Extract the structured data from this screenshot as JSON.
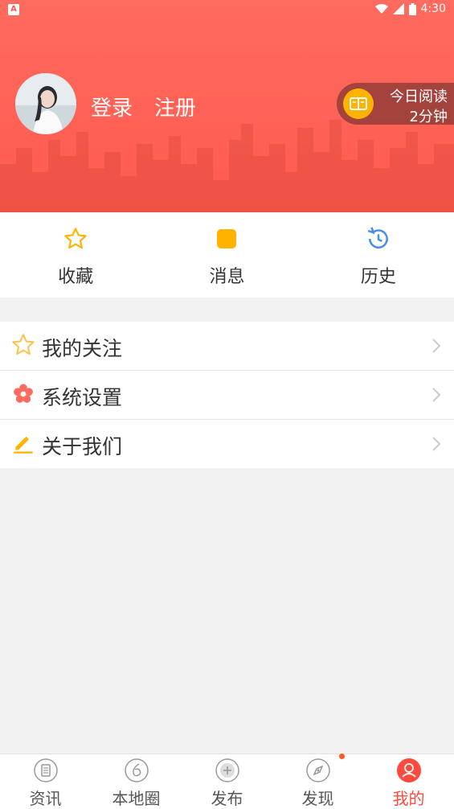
{
  "status_bar": {
    "time": "4:30"
  },
  "header": {
    "login_label": "登录",
    "register_label": "注册",
    "reading": {
      "line1": "今日阅读",
      "line2": "2分钟"
    }
  },
  "quick_actions": [
    {
      "label": "收藏",
      "icon": "star-icon"
    },
    {
      "label": "消息",
      "icon": "message-icon"
    },
    {
      "label": "历史",
      "icon": "history-icon"
    }
  ],
  "menu": [
    {
      "label": "我的关注",
      "icon": "star-outline-icon"
    },
    {
      "label": "系统设置",
      "icon": "flower-settings-icon"
    },
    {
      "label": "关于我们",
      "icon": "pen-icon"
    }
  ],
  "tabs": [
    {
      "label": "资讯",
      "icon": "news-icon"
    },
    {
      "label": "本地圈",
      "icon": "local-circle-icon"
    },
    {
      "label": "发布",
      "icon": "plus-icon"
    },
    {
      "label": "发现",
      "icon": "compass-icon"
    },
    {
      "label": "我的",
      "icon": "user-icon",
      "active": true
    }
  ],
  "colors": {
    "accent": "#ff5a4f",
    "tab_active": "#ff4a3d",
    "star": "#ffb300",
    "history": "#4a90e2"
  }
}
